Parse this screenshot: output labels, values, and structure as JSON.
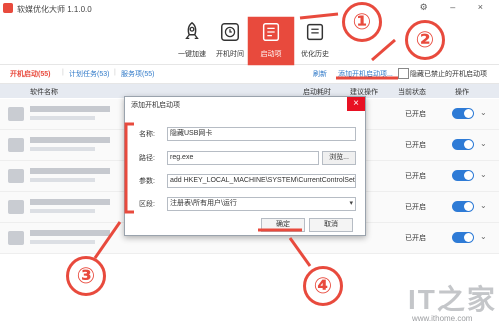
{
  "app": {
    "title": "软媒优化大师 1.1.0.0",
    "window_controls": "⚙ – ×"
  },
  "toolbar": {
    "items": [
      {
        "label": "一键加速",
        "icon": "rocket-icon"
      },
      {
        "label": "开机时间",
        "icon": "clock-icon"
      },
      {
        "label": "启动项",
        "icon": "startup-list-icon",
        "active": true
      },
      {
        "label": "优化历史",
        "icon": "history-icon"
      }
    ]
  },
  "tabs": [
    {
      "label": "开机启动(55)",
      "active": true
    },
    {
      "label": "计划任务(53)"
    },
    {
      "label": "服务项(55)"
    }
  ],
  "actions": {
    "refresh": "刷新",
    "add_startup": "添加开机启动项...",
    "hide_disabled": "隐藏已禁止的开机启动项"
  },
  "table": {
    "headers": [
      "软件名称",
      "启动耗时",
      "建议操作",
      "当前状态",
      "操作"
    ],
    "rows": [
      {
        "status": "已开启"
      },
      {
        "status": "已开启"
      },
      {
        "status": "已开启"
      },
      {
        "status": "已开启"
      },
      {
        "status": "已开启"
      }
    ]
  },
  "dialog": {
    "title": "添加开机启动项",
    "close": "×",
    "name_label": "名称:",
    "name_value": "隐藏USB网卡",
    "path_label": "路径:",
    "path_value": "reg.exe",
    "browse_label": "浏览...",
    "params_label": "参数:",
    "params_value": "add HKEY_LOCAL_MACHINE\\SYSTEM\\CurrentControlSet\\Er",
    "section_label": "区段:",
    "section_value": "注册表\\所有用户\\运行",
    "ok_label": "确定",
    "cancel_label": "取消"
  },
  "annotations": [
    "①",
    "②",
    "③",
    "④"
  ],
  "watermark": {
    "logo": "IT之家",
    "url": "www.ithome.com"
  },
  "colors": {
    "accent": "#e84a3d",
    "link": "#2e78c8",
    "toggle": "#2e7bd6"
  }
}
